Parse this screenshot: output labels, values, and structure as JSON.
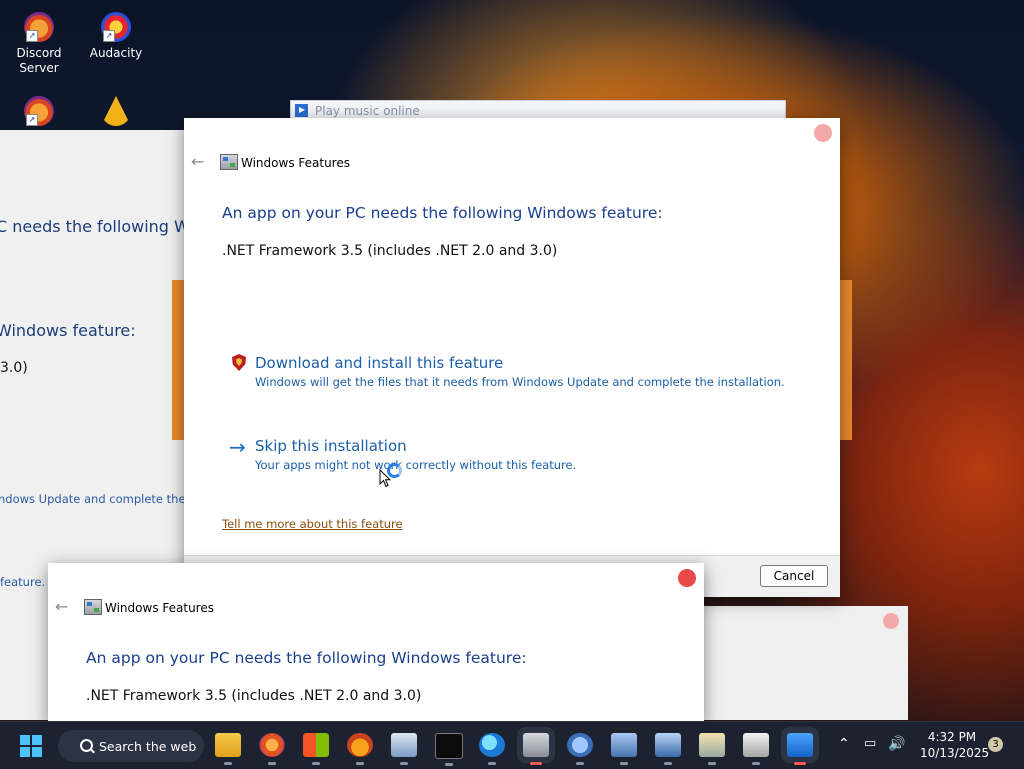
{
  "desktop": {
    "icons": [
      {
        "label": "Discord\nServer",
        "icon": "discord-icon"
      },
      {
        "label": "Audacity",
        "icon": "audacity-icon"
      },
      {
        "label": "",
        "icon": "discord-icon"
      },
      {
        "label": "",
        "icon": "aimp-icon"
      }
    ]
  },
  "background_windows": {
    "music_title": "Play music online",
    "left_heading": "C needs the following Wind",
    "left_feature": "Windows feature:",
    "left_framework": "3.0)",
    "left_update": "ndows Update and complete the in",
    "left_feature2": "feature."
  },
  "dialog_main": {
    "title": "Windows Features",
    "heading": "An app on your PC needs the following Windows feature:",
    "feature": ".NET Framework 3.5 (includes .NET 2.0 and 3.0)",
    "option_download_title": "Download and install this feature",
    "option_download_desc": "Windows will get the files that it needs from Windows Update and complete the installation.",
    "option_skip_title": "Skip this installation",
    "option_skip_desc": "Your apps might not work correctly without this feature.",
    "tell_more": "Tell me more about this feature",
    "cancel": "Cancel",
    "close_color": "#f4a8a8"
  },
  "dialog_second": {
    "title": "Windows Features",
    "heading": "An app on your PC needs the following Windows feature:",
    "feature": ".NET Framework 3.5 (includes .NET 2.0 and 3.0)",
    "close_color": "#e84a4a"
  },
  "taskbar": {
    "search_label": "Search the web",
    "time": "4:32 PM",
    "date": "10/13/2025",
    "notification_count": "3",
    "apps": [
      "file-explorer-icon",
      "firefox-icon",
      "microsoft-store-icon",
      "vlc-icon",
      "resource-monitor-icon",
      "terminal-icon",
      "edge-icon",
      "windows-features-icon",
      "internet-options-icon",
      "network-icon",
      "network-icon-2",
      "archive-icon",
      "recycle-icon",
      "media-player-icon"
    ]
  },
  "colors": {
    "accent": "#1b5fa8",
    "heading": "#1b3f8c",
    "link": "#8a4f10",
    "taskbar": "#1c2230"
  }
}
